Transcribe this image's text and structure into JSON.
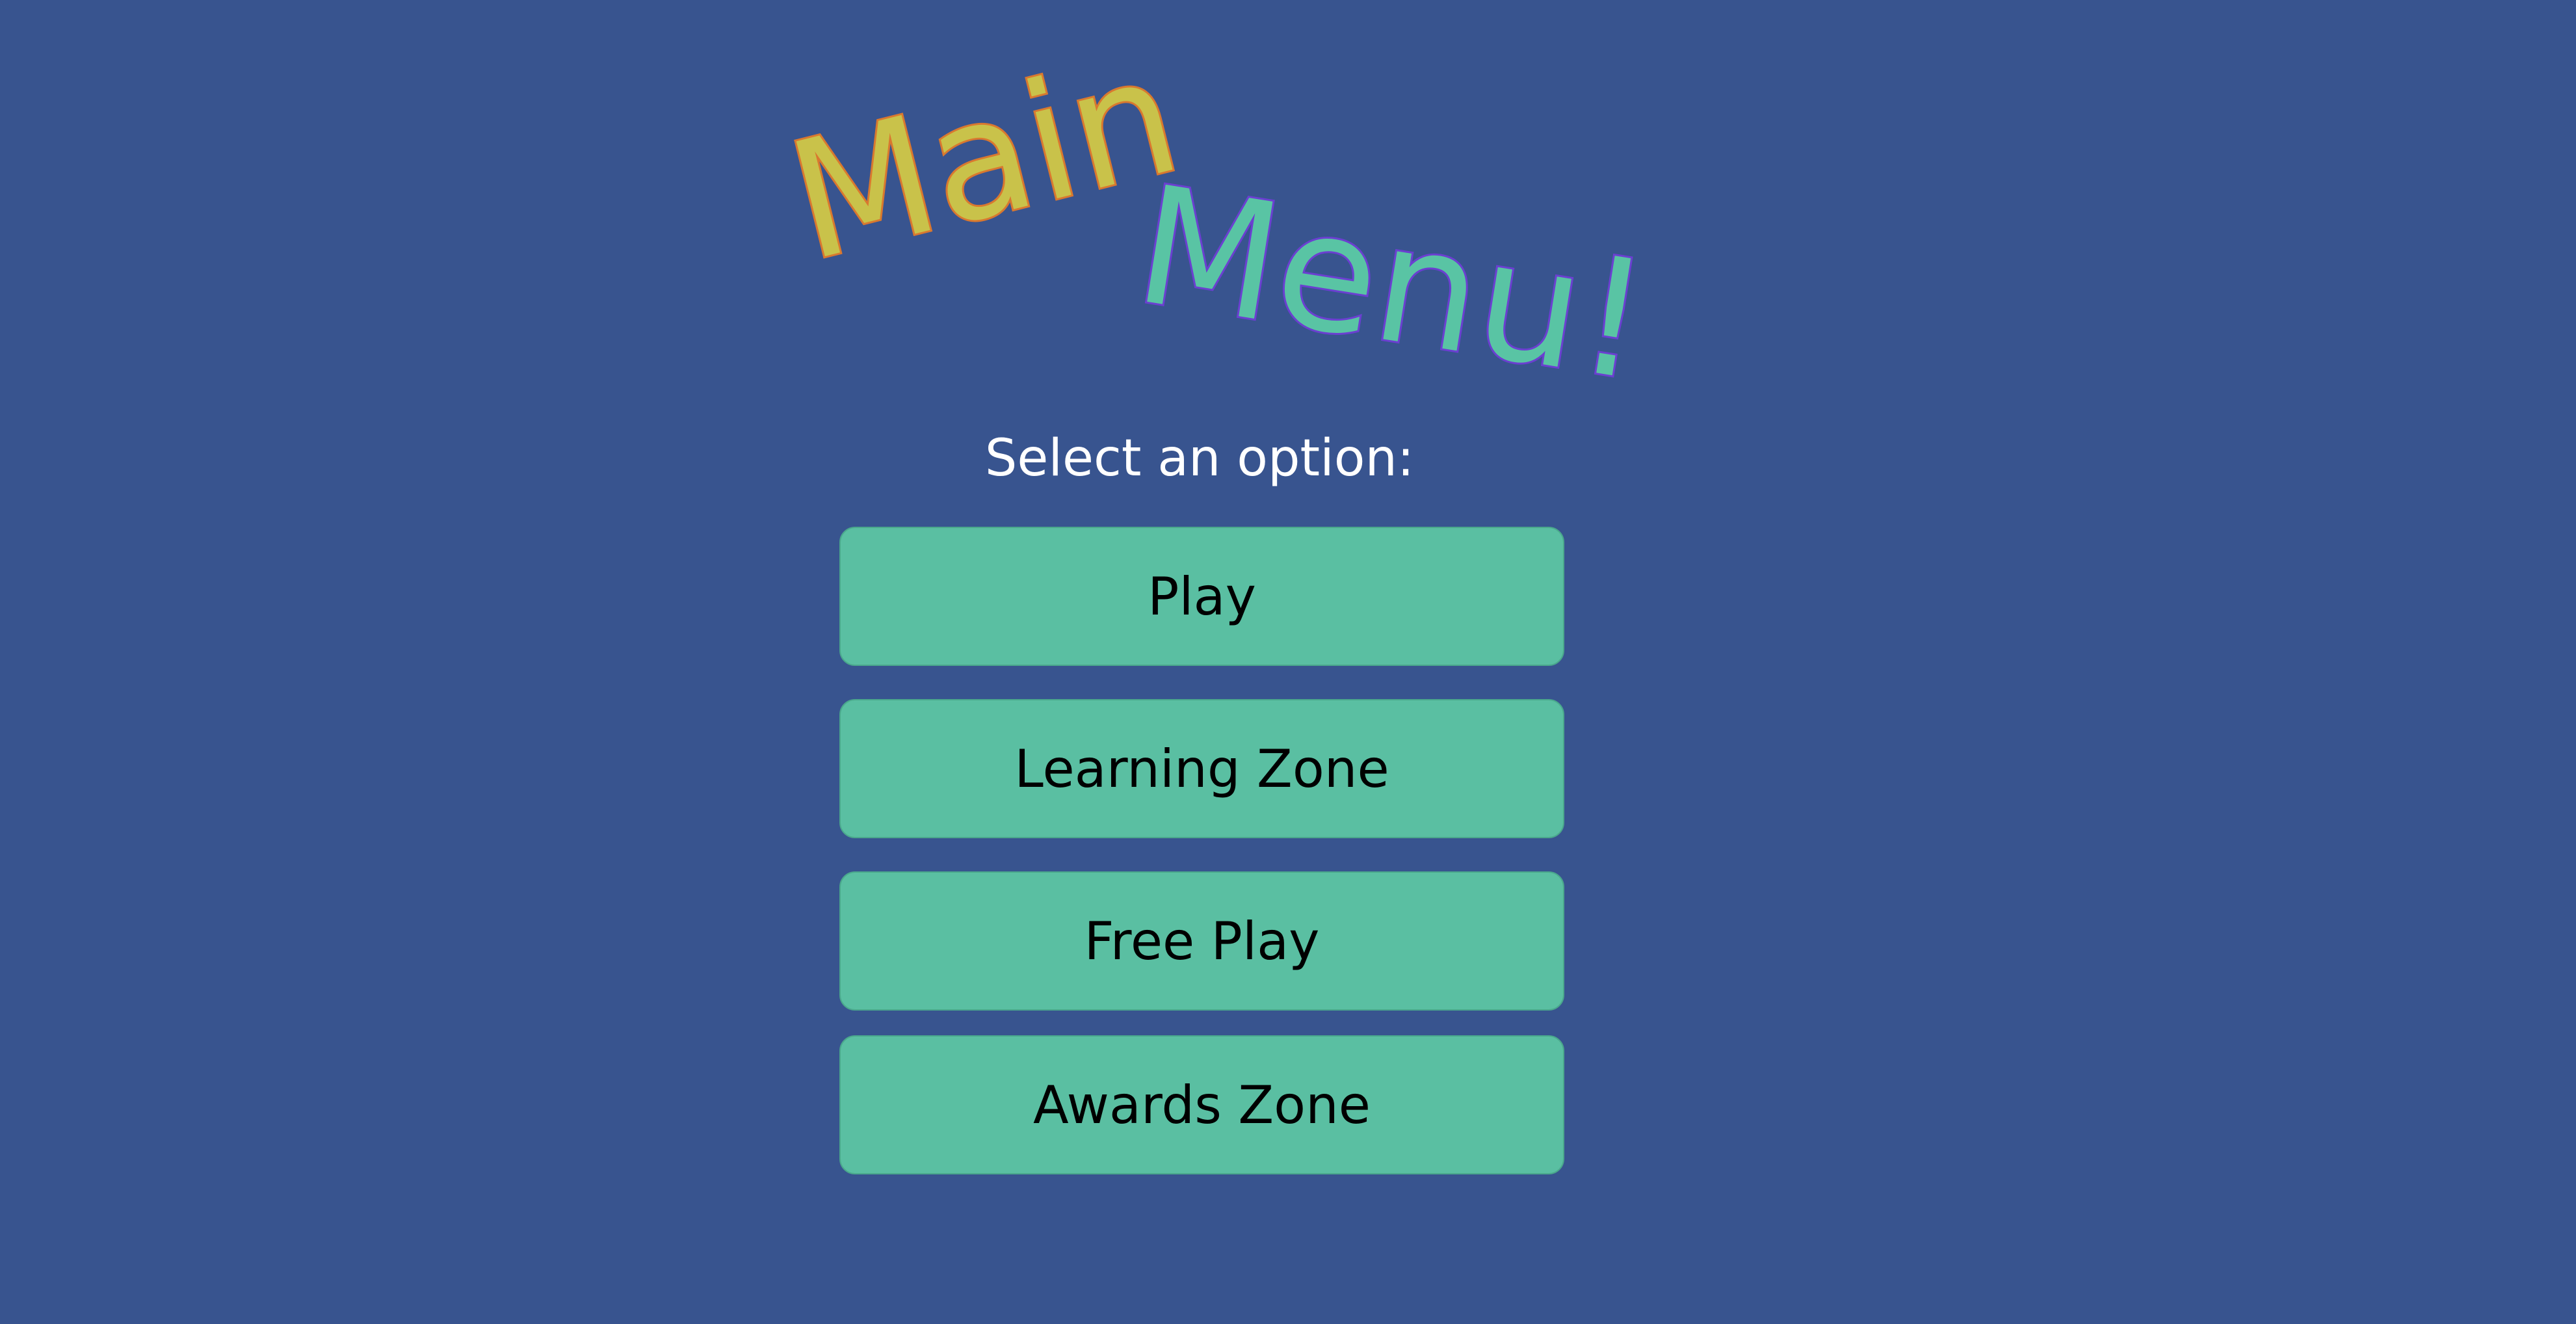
{
  "title": {
    "word1": "Main",
    "word2": "Menu!",
    "word1_fill": "#c9c24a",
    "word1_stroke": "#d9782f",
    "word2_fill": "#59c4a4",
    "word2_stroke": "#6b3fd1"
  },
  "prompt": "Select an option:",
  "menu": {
    "items": [
      {
        "label": "Play"
      },
      {
        "label": "Learning Zone"
      },
      {
        "label": "Free Play"
      },
      {
        "label": "Awards Zone"
      }
    ]
  },
  "colors": {
    "background": "#38548f",
    "button_fill": "#5abfa2",
    "button_text": "#000000",
    "prompt_text": "#ffffff"
  }
}
